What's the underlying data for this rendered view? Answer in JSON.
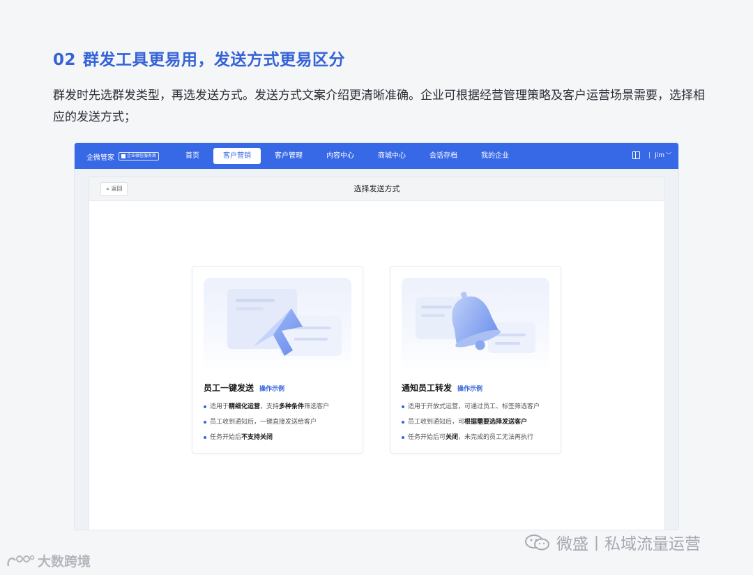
{
  "heading": {
    "number": "02",
    "title": "群发工具更易用，发送方式更易区分"
  },
  "description": "群发时先选群发类型，再选发送方式。发送方式文案介绍更清晰准确。企业可根据经营管理策略及客户运营场景需要，选择相应的发送方式；",
  "app": {
    "brand": "企微管家",
    "brand_badge": "企业微信服务商",
    "nav": [
      "首页",
      "客户营销",
      "客户管理",
      "内容中心",
      "商城中心",
      "会话存档",
      "我的企业"
    ],
    "nav_active_index": 1,
    "user": "Jim",
    "separator": "|",
    "back_label": "« 返回",
    "panel_title": "选择发送方式",
    "cards": [
      {
        "title": "员工一键发送",
        "link": "操作示例",
        "bullets": [
          {
            "pre": "适用于",
            "bold": "精细化运营",
            "mid": "，支持",
            "bold2": "多种条件",
            "post": "筛选客户"
          },
          {
            "pre": "员工收到通知后，一键直接发送给客户",
            "bold": "",
            "mid": "",
            "bold2": "",
            "post": ""
          },
          {
            "pre": "任务开始后",
            "bold": "不支持关闭",
            "mid": "",
            "bold2": "",
            "post": ""
          }
        ]
      },
      {
        "title": "通知员工转发",
        "link": "操作示例",
        "bullets": [
          {
            "pre": "适用于开放式运营，可通过员工、标签筛选客户",
            "bold": "",
            "mid": "",
            "bold2": "",
            "post": ""
          },
          {
            "pre": "员工收到通知后，可",
            "bold": "根据需要选择发送客户",
            "mid": "",
            "bold2": "",
            "post": ""
          },
          {
            "pre": "任务开始后可",
            "bold": "关闭",
            "mid": "，未完成的员工无法再执行",
            "bold2": "",
            "post": ""
          }
        ]
      }
    ]
  },
  "watermarks": {
    "right": "微盛丨私域流量运营",
    "left": "大数跨境"
  },
  "colors": {
    "accent": "#3768e6",
    "heading": "#3563d7",
    "link": "#3464db"
  }
}
